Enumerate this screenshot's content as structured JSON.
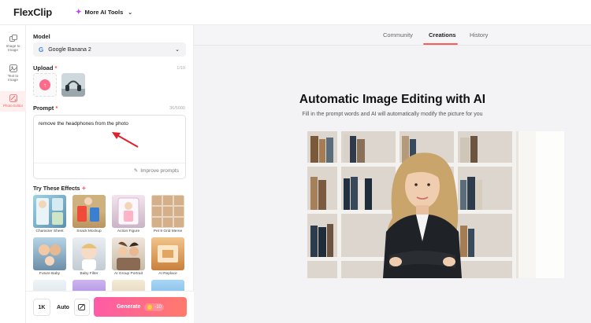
{
  "app": {
    "logo": "FlexClip",
    "ai_tools_label": "More AI Tools"
  },
  "rail": {
    "items": [
      {
        "label_line1": "Image to",
        "label_line2": "Image"
      },
      {
        "label_line1": "Text to",
        "label_line2": "Image"
      },
      {
        "label_line1": "Photo Editor",
        "label_line2": ""
      }
    ]
  },
  "panel": {
    "model_label": "Model",
    "model_value": "Google Banana 2",
    "upload_label": "Upload",
    "upload_counter": "1/10",
    "prompt_label": "Prompt",
    "prompt_counter": "36/5000",
    "prompt_text": "remove the headphones from the photo",
    "improve_label": "Improve prompts",
    "effects_title": "Try These Effects",
    "effects": [
      {
        "caption": "Character Sheet"
      },
      {
        "caption": "Snack Mockup"
      },
      {
        "caption": "Action Figure"
      },
      {
        "caption": "Pet 9 Grid Meme"
      },
      {
        "caption": "Future Baby"
      },
      {
        "caption": "Baby Filter"
      },
      {
        "caption": "AI Group Portrait"
      },
      {
        "caption": "AI Replace"
      }
    ]
  },
  "bottom": {
    "resolution": "1K",
    "ratio": "Auto",
    "generate_label": "Generate",
    "credits": "-10"
  },
  "main": {
    "tabs": [
      "Community",
      "Creations",
      "History"
    ],
    "active_tab": "Creations",
    "title": "Automatic Image Editing with AI",
    "subtitle": "Fill in the prompt words and AI will automatically modify the picture for you"
  },
  "colors": {
    "accent": "#ff5a5a",
    "generate_start": "#ff5aa8",
    "generate_end": "#ff7a6b"
  }
}
